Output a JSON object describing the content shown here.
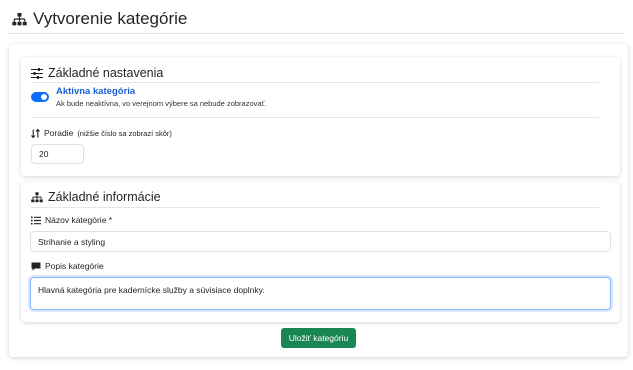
{
  "header": {
    "title": "Vytvorenie kategórie",
    "icon": "sitemap-icon"
  },
  "basic_settings": {
    "title": "Základné nastavenia",
    "icon": "sliders-icon",
    "active": {
      "label": "Aktívna kategória",
      "help": "Ak bude neaktívna, vo verejnom výbere sa nebude zobrazovať.",
      "checked": true
    },
    "order": {
      "label": "Poradie",
      "hint": "(nižšie číslo sa zobrazí skôr)",
      "value": "20",
      "icon": "sort-icon"
    }
  },
  "basic_info": {
    "title": "Základné informácie",
    "icon": "sitemap-icon",
    "name": {
      "label": "Názov kategórie *",
      "value": "Strihanie a styling",
      "icon": "list-icon"
    },
    "description": {
      "label": "Popis kategórie",
      "value": "Hlavná kategória pre kadernícke služby a súvisiace doplnky.",
      "icon": "comment-icon"
    }
  },
  "actions": {
    "save_label": "Uložiť kategóriu"
  },
  "colors": {
    "accent": "#0d6efd",
    "success": "#198754",
    "link": "#1a5fd6"
  }
}
